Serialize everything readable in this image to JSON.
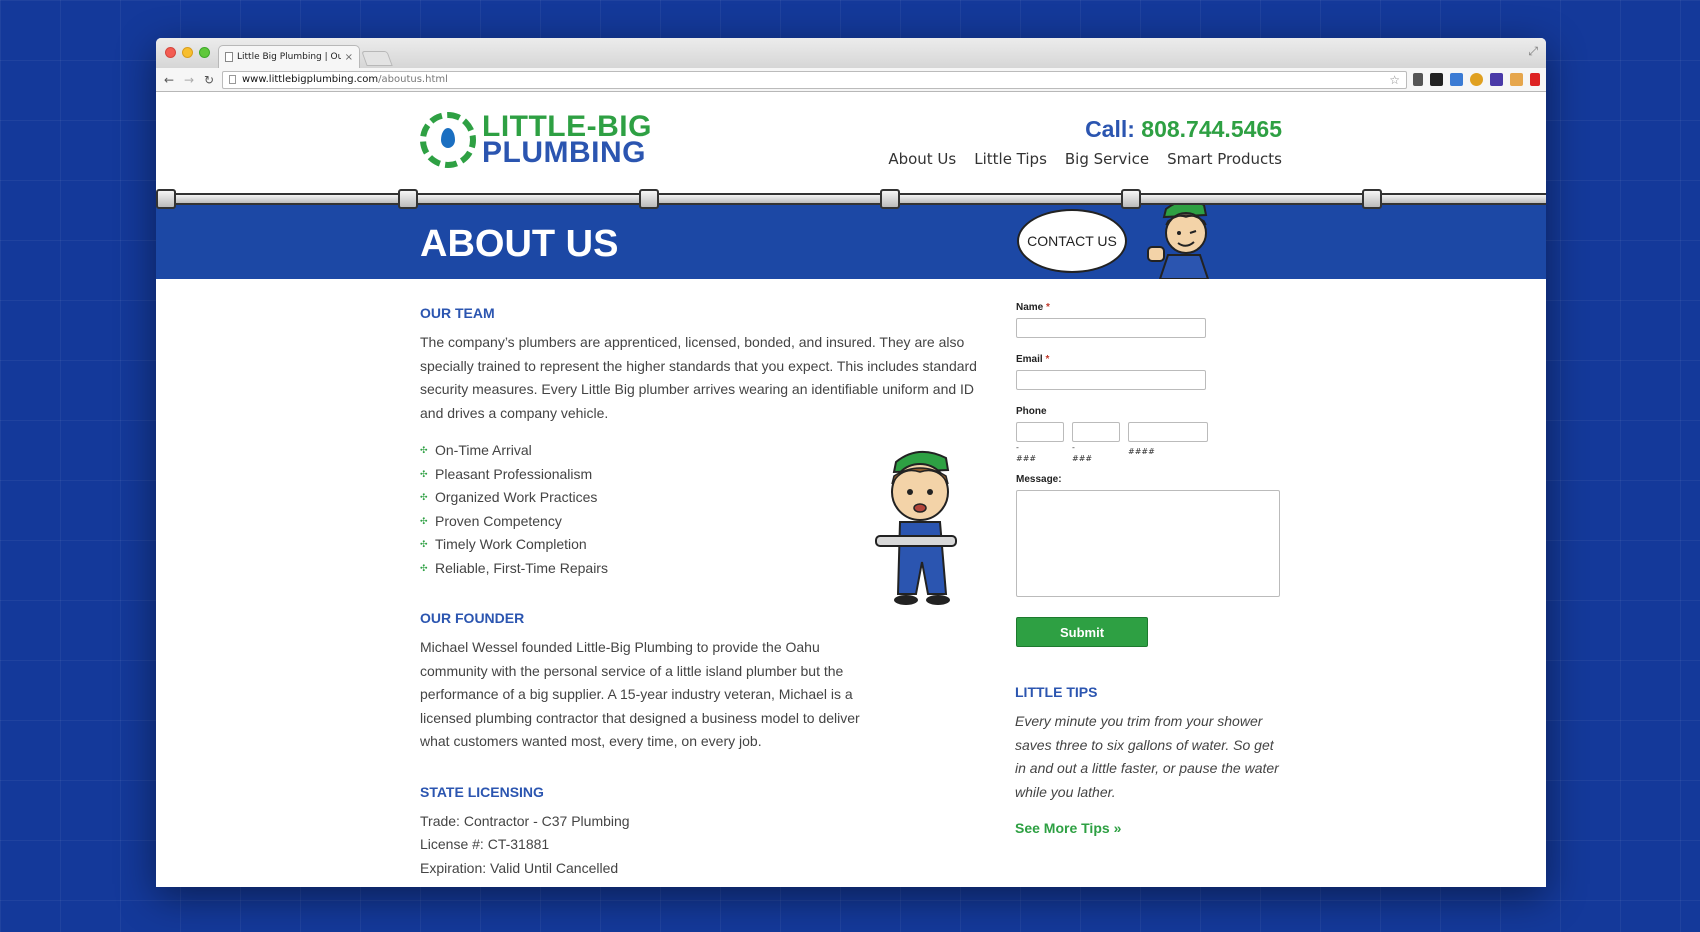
{
  "browser": {
    "tab_title": "Little Big Plumbing | Our T",
    "tab_close": "×",
    "url_host": "www.littlebigplumbing.com",
    "url_path": "/aboutus.html",
    "back_icon": "←",
    "forward_icon": "→",
    "reload_icon": "↻",
    "star_icon": "☆",
    "expand_icon": "⤢"
  },
  "header": {
    "logo_line1": "LITTLE-BIG",
    "logo_line2": "PLUMBING",
    "call_label": "Call:",
    "call_number": "808.744.5465",
    "nav": [
      "About Us",
      "Little Tips",
      "Big Service",
      "Smart Products"
    ]
  },
  "hero": {
    "title": "ABOUT US",
    "contact_bubble": "CONTACT US"
  },
  "team": {
    "heading": "OUR TEAM",
    "paragraph": "The company’s plumbers are apprenticed, licensed, bonded, and insured. They are also specially trained to represent the higher standards that you expect. This includes standard security measures. Every Little Big plumber arrives wearing an identifiable uniform and ID and drives a company vehicle.",
    "bullets": [
      "On-Time Arrival",
      "Pleasant Professionalism",
      "Organized Work Practices",
      "Proven Competency",
      "Timely Work Completion",
      "Reliable, First-Time Repairs"
    ]
  },
  "founder": {
    "heading": "OUR FOUNDER",
    "paragraph": "Michael Wessel founded Little-Big Plumbing to provide the Oahu community with the personal service of a little island plumber but the performance of a big supplier. A 15-year industry veteran, Michael is a licensed plumbing contractor that designed a business model to deliver what customers wanted most, every time, on every job."
  },
  "licensing": {
    "heading": "STATE LICENSING",
    "lines": [
      "Trade: Contractor - C37 Plumbing",
      "License #: CT-31881",
      "Expiration: Valid Until Cancelled"
    ]
  },
  "form": {
    "name_label": "Name",
    "email_label": "Email",
    "required_mark": "*",
    "phone_label": "Phone",
    "phone_hints": [
      "-\n###",
      "-\n###",
      "####"
    ],
    "message_label": "Message:",
    "submit_label": "Submit"
  },
  "tips": {
    "heading": "LITTLE TIPS",
    "text": "Every minute you trim from your shower saves three to six gallons of water. So get in and out a little faster, or pause the water while you lather.",
    "see_more": "See More Tips",
    "see_more_icon": "»"
  },
  "colors": {
    "background": "#14399a",
    "brand_green": "#2ea043",
    "brand_blue": "#2b55b0",
    "hero_blue": "#1c48a5"
  }
}
